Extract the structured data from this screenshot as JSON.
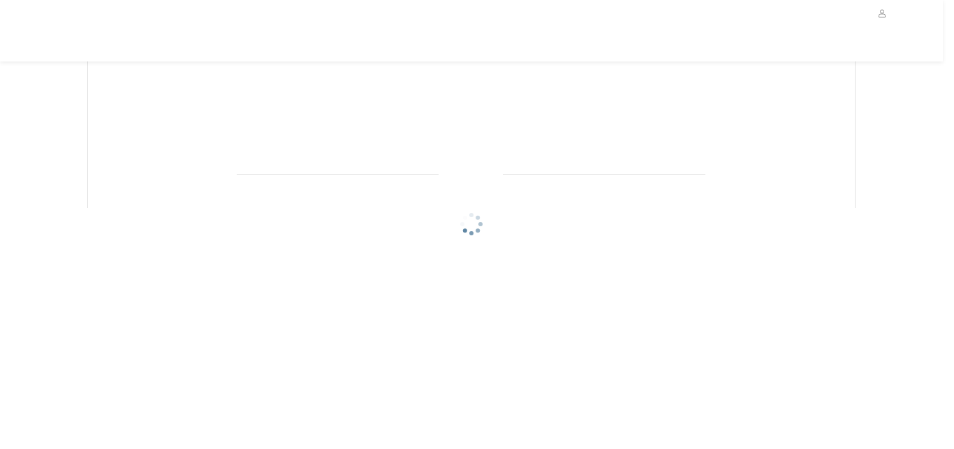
{
  "header": {
    "user_menu": true
  },
  "content": {
    "loading": true
  }
}
